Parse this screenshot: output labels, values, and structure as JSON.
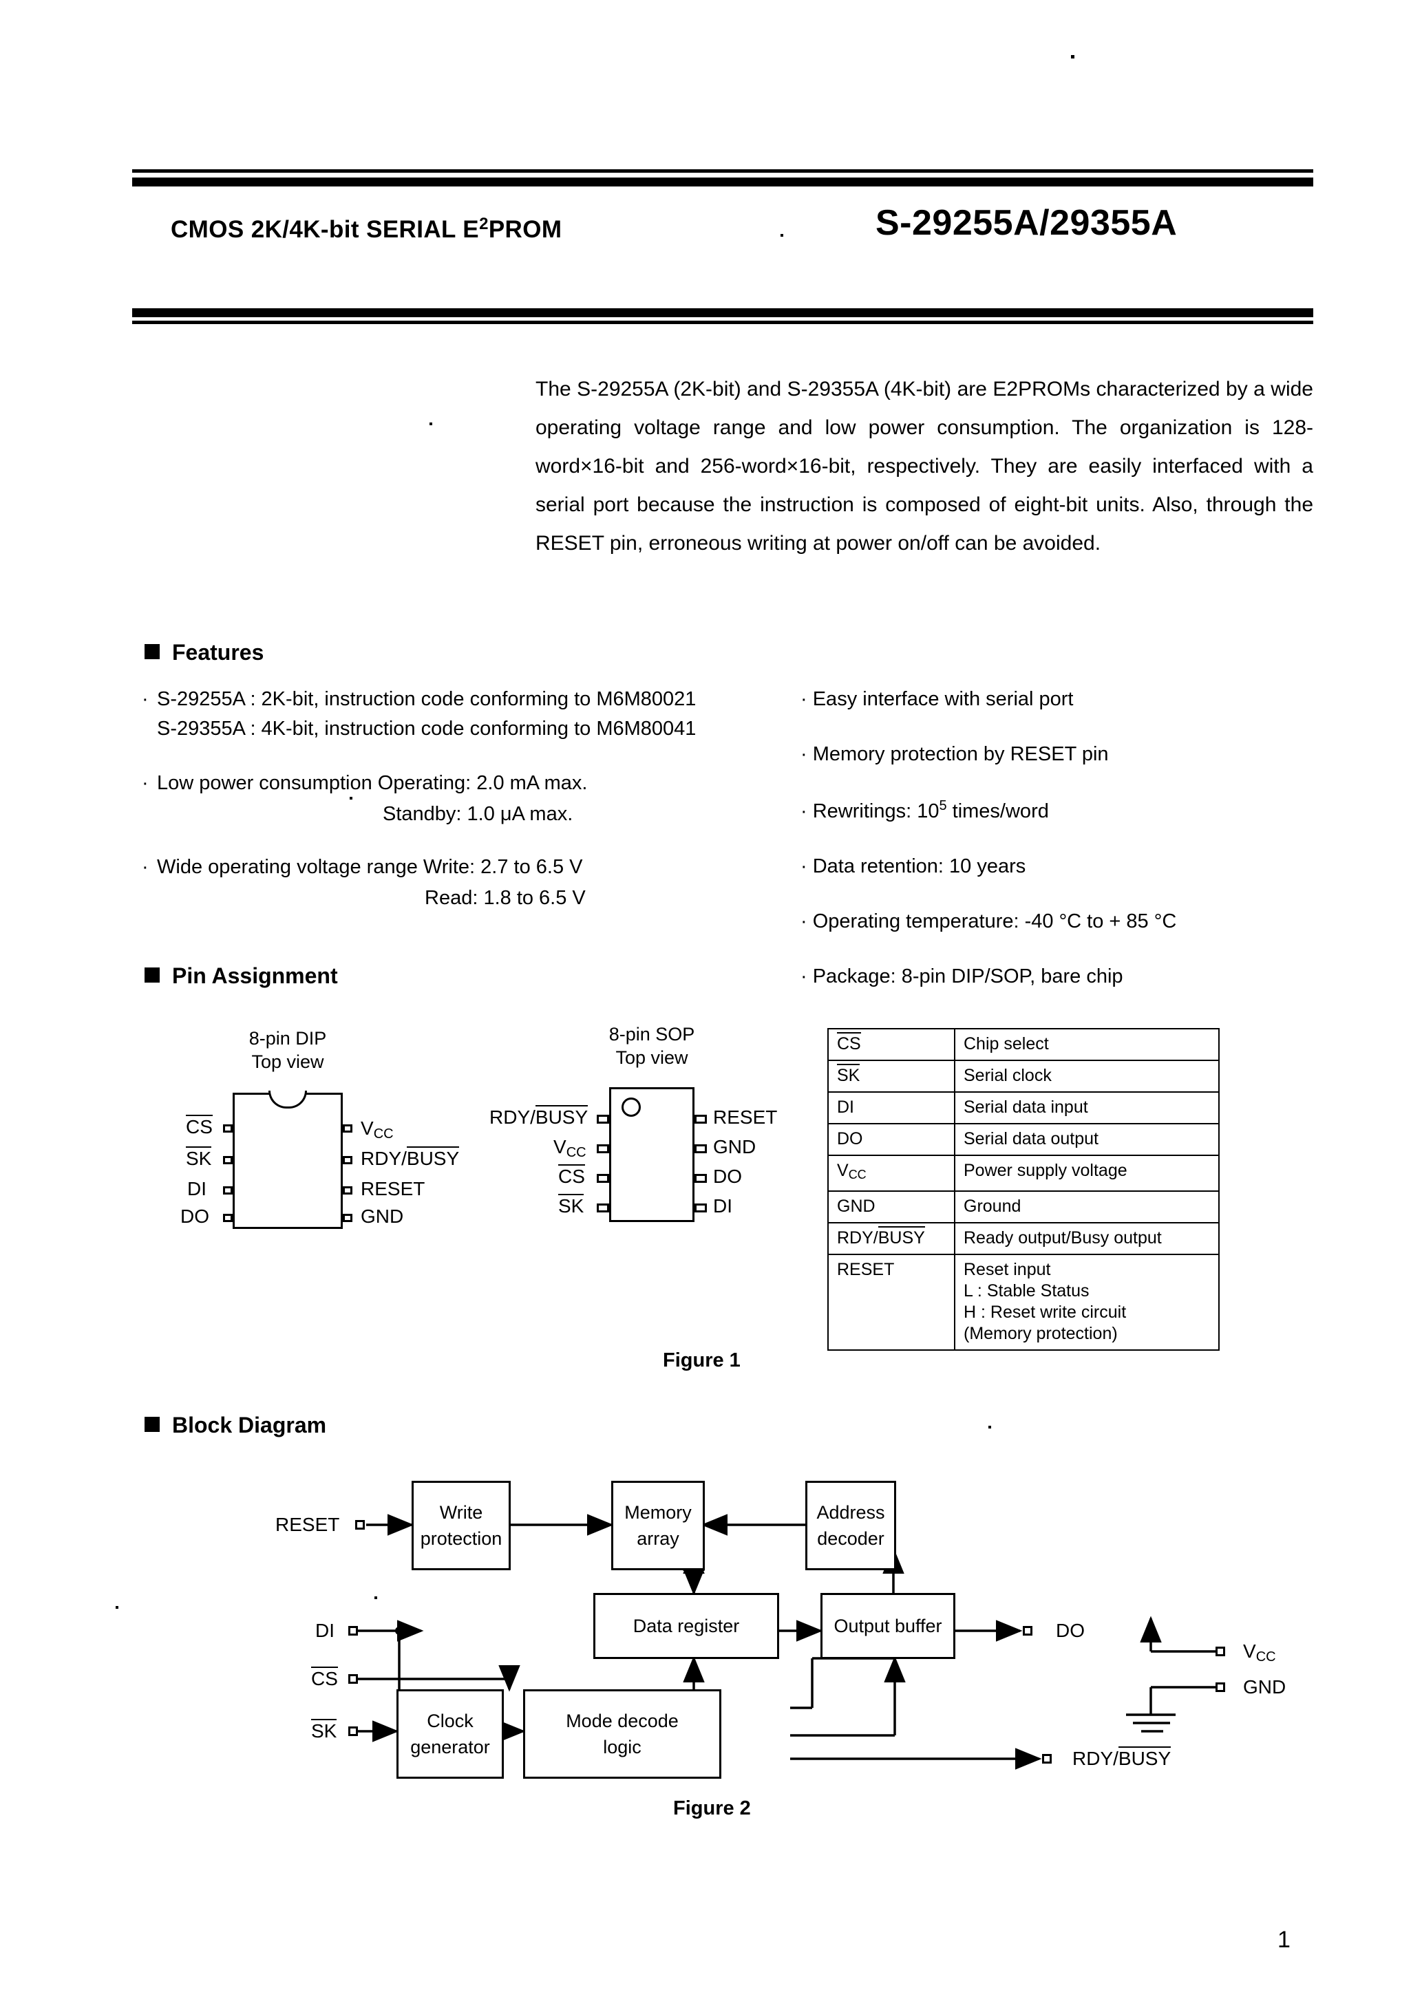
{
  "header": {
    "left_title_prefix": "CMOS 2K/4K-bit SERIAL E",
    "left_title_sup": "2",
    "left_title_suffix": "PROM",
    "part_numbers": "S-29255A/29355A"
  },
  "intro": {
    "paragraph": "The S-29255A (2K-bit) and S-29355A (4K-bit) are E2PROMs characterized by a wide operating voltage range and low power consumption.   The organization is 128-word×16-bit and 256-word×16-bit, respectively.   They are easily interfaced with a serial port because the instruction is composed of eight-bit units.   Also, through the RESET pin, erroneous writing at power on/off can be avoided."
  },
  "sections": {
    "features_heading": "Features",
    "pin_assignment_heading": "Pin Assignment",
    "block_diagram_heading": "Block Diagram"
  },
  "features": {
    "left": [
      {
        "line1": "S-29255A :   2K-bit,  instruction code conforming to M6M80021",
        "line2": "S-29355A :   4K-bit,  instruction code conforming to M6M80041"
      },
      {
        "line1": "Low power consumption   Operating: 2.0 mA max.",
        "line2": "Standby: 1.0 μA max."
      },
      {
        "line1": "Wide operating voltage range      Write: 2.7 to 6.5 V",
        "line2": "Read: 1.8 to 6.5 V"
      }
    ],
    "right": [
      {
        "text": "Easy interface with serial port"
      },
      {
        "text": "Memory protection by RESET pin"
      },
      {
        "text_prefix": "Rewritings: 10",
        "sup": "5",
        "text_suffix": " times/word"
      },
      {
        "text": "Data retention: 10 years"
      },
      {
        "text": "Operating temperature: -40 °C to + 85 °C"
      },
      {
        "text": "Package: 8-pin DIP/SOP, bare chip"
      }
    ]
  },
  "pin_assignment": {
    "dip": {
      "title_line1": "8-pin  DIP",
      "title_line2": "Top view",
      "left_pins": [
        "CS",
        "SK",
        "DI",
        "DO"
      ],
      "right_pins": [
        "VCC",
        "RDY/BUSY",
        "RESET",
        "GND"
      ],
      "vcc_base": "V",
      "vcc_sub": "CC",
      "rdy_prefix": "RDY/",
      "rdy_overline": "BUSY"
    },
    "sop": {
      "title_line1": "8-pin SOP",
      "title_line2": "Top view",
      "left_pins": [
        "RDY/BUSY",
        "VCC",
        "CS",
        "SK"
      ],
      "right_pins": [
        "RESET",
        "GND",
        "DO",
        "DI"
      ]
    },
    "table": {
      "rows": [
        {
          "name": "CS",
          "overline": true,
          "desc": "Chip select"
        },
        {
          "name": "SK",
          "overline": true,
          "desc": "Serial clock"
        },
        {
          "name": "DI",
          "overline": false,
          "desc": "Serial data input"
        },
        {
          "name": "DO",
          "overline": false,
          "desc": "Serial data output"
        },
        {
          "name": "VCC",
          "overline": false,
          "desc": "Power supply voltage"
        },
        {
          "name": "GND",
          "overline": false,
          "desc": "Ground"
        },
        {
          "name": "RDY/BUSY",
          "overline": false,
          "desc": "Ready output/Busy output"
        },
        {
          "name": "RESET",
          "overline": false,
          "desc": "Reset input\nL : Stable Status\nH : Reset write circuit\n      (Memory protection)"
        }
      ]
    },
    "figure_caption": "Figure 1"
  },
  "block_diagram": {
    "blocks": [
      {
        "id": "write-protection",
        "label": "Write\nprotection"
      },
      {
        "id": "memory-array",
        "label": "Memory array"
      },
      {
        "id": "address-decoder",
        "label": "Address\ndecoder"
      },
      {
        "id": "data-register",
        "label": "Data register"
      },
      {
        "id": "output-buffer",
        "label": "Output buffer"
      },
      {
        "id": "clock-generator",
        "label": "Clock\ngenerator"
      },
      {
        "id": "mode-decode-logic",
        "label": "Mode decode\nlogic"
      }
    ],
    "inputs": [
      {
        "id": "reset",
        "label": "RESET"
      },
      {
        "id": "di",
        "label": "DI"
      },
      {
        "id": "cs",
        "label": "CS"
      },
      {
        "id": "sk",
        "label": "SK"
      }
    ],
    "outputs": [
      {
        "id": "do",
        "label": "DO"
      },
      {
        "id": "rdy-busy",
        "label": "RDY/BUSY"
      }
    ],
    "power": [
      {
        "id": "vcc",
        "label_base": "V",
        "label_sub": "CC"
      },
      {
        "id": "gnd",
        "label": "GND"
      }
    ],
    "figure_caption": "Figure 2"
  },
  "page_number": "1"
}
